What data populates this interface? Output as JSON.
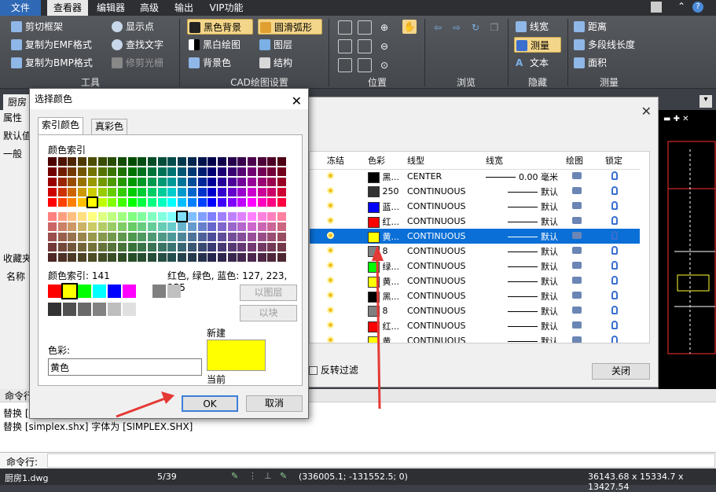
{
  "menubar": {
    "items": [
      "文件",
      "查看器",
      "编辑器",
      "高级",
      "输出",
      "VIP功能"
    ]
  },
  "ribbon": {
    "tools": [
      "剪切框架",
      "复制为EMF格式",
      "复制为BMP格式",
      "显示点",
      "查找文字",
      "修剪光栅"
    ],
    "cad_settings": [
      "黑色背景",
      "黑白绘图",
      "背景色",
      "圆滑弧形",
      "图层",
      "结构"
    ],
    "hidden": [
      "线宽",
      "测量",
      "文本"
    ],
    "measure": [
      "距离",
      "多段线长度",
      "面积"
    ],
    "groups": [
      "工具",
      "CAD绘图设置",
      "位置",
      "浏览",
      "隐藏",
      "测量"
    ]
  },
  "tabs": {
    "file_tab": "厨房",
    "left_labels": [
      "属性",
      "默认值",
      "一般",
      "收藏夹",
      "名称"
    ]
  },
  "layers": {
    "headers": [
      "冻结",
      "色彩",
      "线型",
      "线宽",
      "绘图",
      "锁定"
    ],
    "rows": [
      {
        "color": "#000000",
        "name": "黑...",
        "linetype": "CENTER",
        "lw": "0.00 毫米",
        "sel": false
      },
      {
        "color": "#333333",
        "name": "250",
        "linetype": "CONTINUOUS",
        "lw": "默认",
        "sel": false
      },
      {
        "color": "#0000ff",
        "name": "蓝...",
        "linetype": "CONTINUOUS",
        "lw": "默认",
        "sel": false
      },
      {
        "color": "#ff0000",
        "name": "红...",
        "linetype": "CONTINUOUS",
        "lw": "默认",
        "sel": false
      },
      {
        "color": "#ffff00",
        "name": "黄...",
        "linetype": "CONTINUOUS",
        "lw": "默认",
        "sel": true
      },
      {
        "color": "#808080",
        "name": "8",
        "linetype": "CONTINUOUS",
        "lw": "默认",
        "sel": false
      },
      {
        "color": "#00ff00",
        "name": "绿...",
        "linetype": "CONTINUOUS",
        "lw": "默认",
        "sel": false
      },
      {
        "color": "#ffff00",
        "name": "黄...",
        "linetype": "CONTINUOUS",
        "lw": "默认",
        "sel": false
      },
      {
        "color": "#000000",
        "name": "黑...",
        "linetype": "CONTINUOUS",
        "lw": "默认",
        "sel": false
      },
      {
        "color": "#808080",
        "name": "8",
        "linetype": "CONTINUOUS",
        "lw": "默认",
        "sel": false
      },
      {
        "color": "#ff0000",
        "name": "红...",
        "linetype": "CONTINUOUS",
        "lw": "默认",
        "sel": false
      },
      {
        "color": "#ffff00",
        "name": "黄...",
        "linetype": "CONTINUOUS",
        "lw": "默认",
        "sel": false
      }
    ],
    "reverse_filter": "反转过滤",
    "close_label": "关闭"
  },
  "command": {
    "tab_label": "命令行",
    "lines": [
      "替换 [",
      "替换 [simplex.shx] 字体为 [SIMPLEX.SHX]"
    ],
    "prompt": "命令行:"
  },
  "status": {
    "file": "厨房1.dwg",
    "page": "5/39",
    "coords": "(336005.1; -131552.5; 0)",
    "dims": "36143.68 x 15334.7 x 13427.54"
  },
  "dialog": {
    "title": "选择颜色",
    "tab_index": "索引颜色",
    "tab_true": "真彩色",
    "palette_label": "颜色索引",
    "index_text": "颜色索引: 141",
    "rgb_text": "红色, 绿色, 蓝色: 127, 223, 255",
    "by_layer": "以图层",
    "by_block": "以块",
    "color_label": "色彩:",
    "color_value": "黄色",
    "new_label": "新建",
    "current_label": "当前",
    "new_color": "#ffff00",
    "ok": "OK",
    "cancel": "取消"
  }
}
